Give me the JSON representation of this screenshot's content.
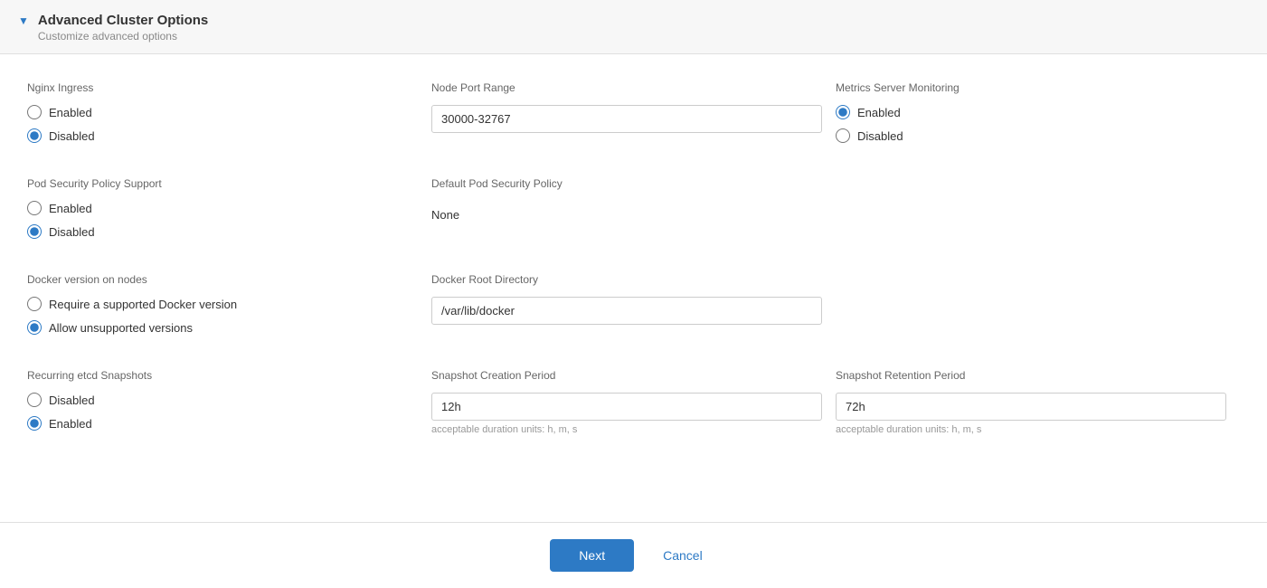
{
  "accordion": {
    "title": "Advanced Cluster Options",
    "subtitle": "Customize advanced options",
    "arrow": "▼"
  },
  "sections": {
    "nginx_ingress": {
      "label": "Nginx Ingress",
      "options": [
        "Enabled",
        "Disabled"
      ],
      "selected": "Disabled"
    },
    "node_port_range": {
      "label": "Node Port Range",
      "value": "30000-32767"
    },
    "metrics_server": {
      "label": "Metrics Server Monitoring",
      "options": [
        "Enabled",
        "Disabled"
      ],
      "selected": "Enabled"
    },
    "pod_security_support": {
      "label": "Pod Security Policy Support",
      "options": [
        "Enabled",
        "Disabled"
      ],
      "selected": "Disabled"
    },
    "default_pod_security": {
      "label": "Default Pod Security Policy",
      "value": "None"
    },
    "docker_version": {
      "label": "Docker version on nodes",
      "options": [
        "Require a supported Docker version",
        "Allow unsupported versions"
      ],
      "selected": "Allow unsupported versions"
    },
    "docker_root": {
      "label": "Docker Root Directory",
      "value": "/var/lib/docker"
    },
    "recurring_etcd": {
      "label": "Recurring etcd Snapshots",
      "options": [
        "Disabled",
        "Enabled"
      ],
      "selected": "Enabled"
    },
    "snapshot_creation": {
      "label": "Snapshot Creation Period",
      "value": "12h",
      "hint": "acceptable duration units: h, m, s"
    },
    "snapshot_retention": {
      "label": "Snapshot Retention Period",
      "value": "72h",
      "hint": "acceptable duration units: h, m, s"
    }
  },
  "footer": {
    "next_label": "Next",
    "cancel_label": "Cancel"
  }
}
